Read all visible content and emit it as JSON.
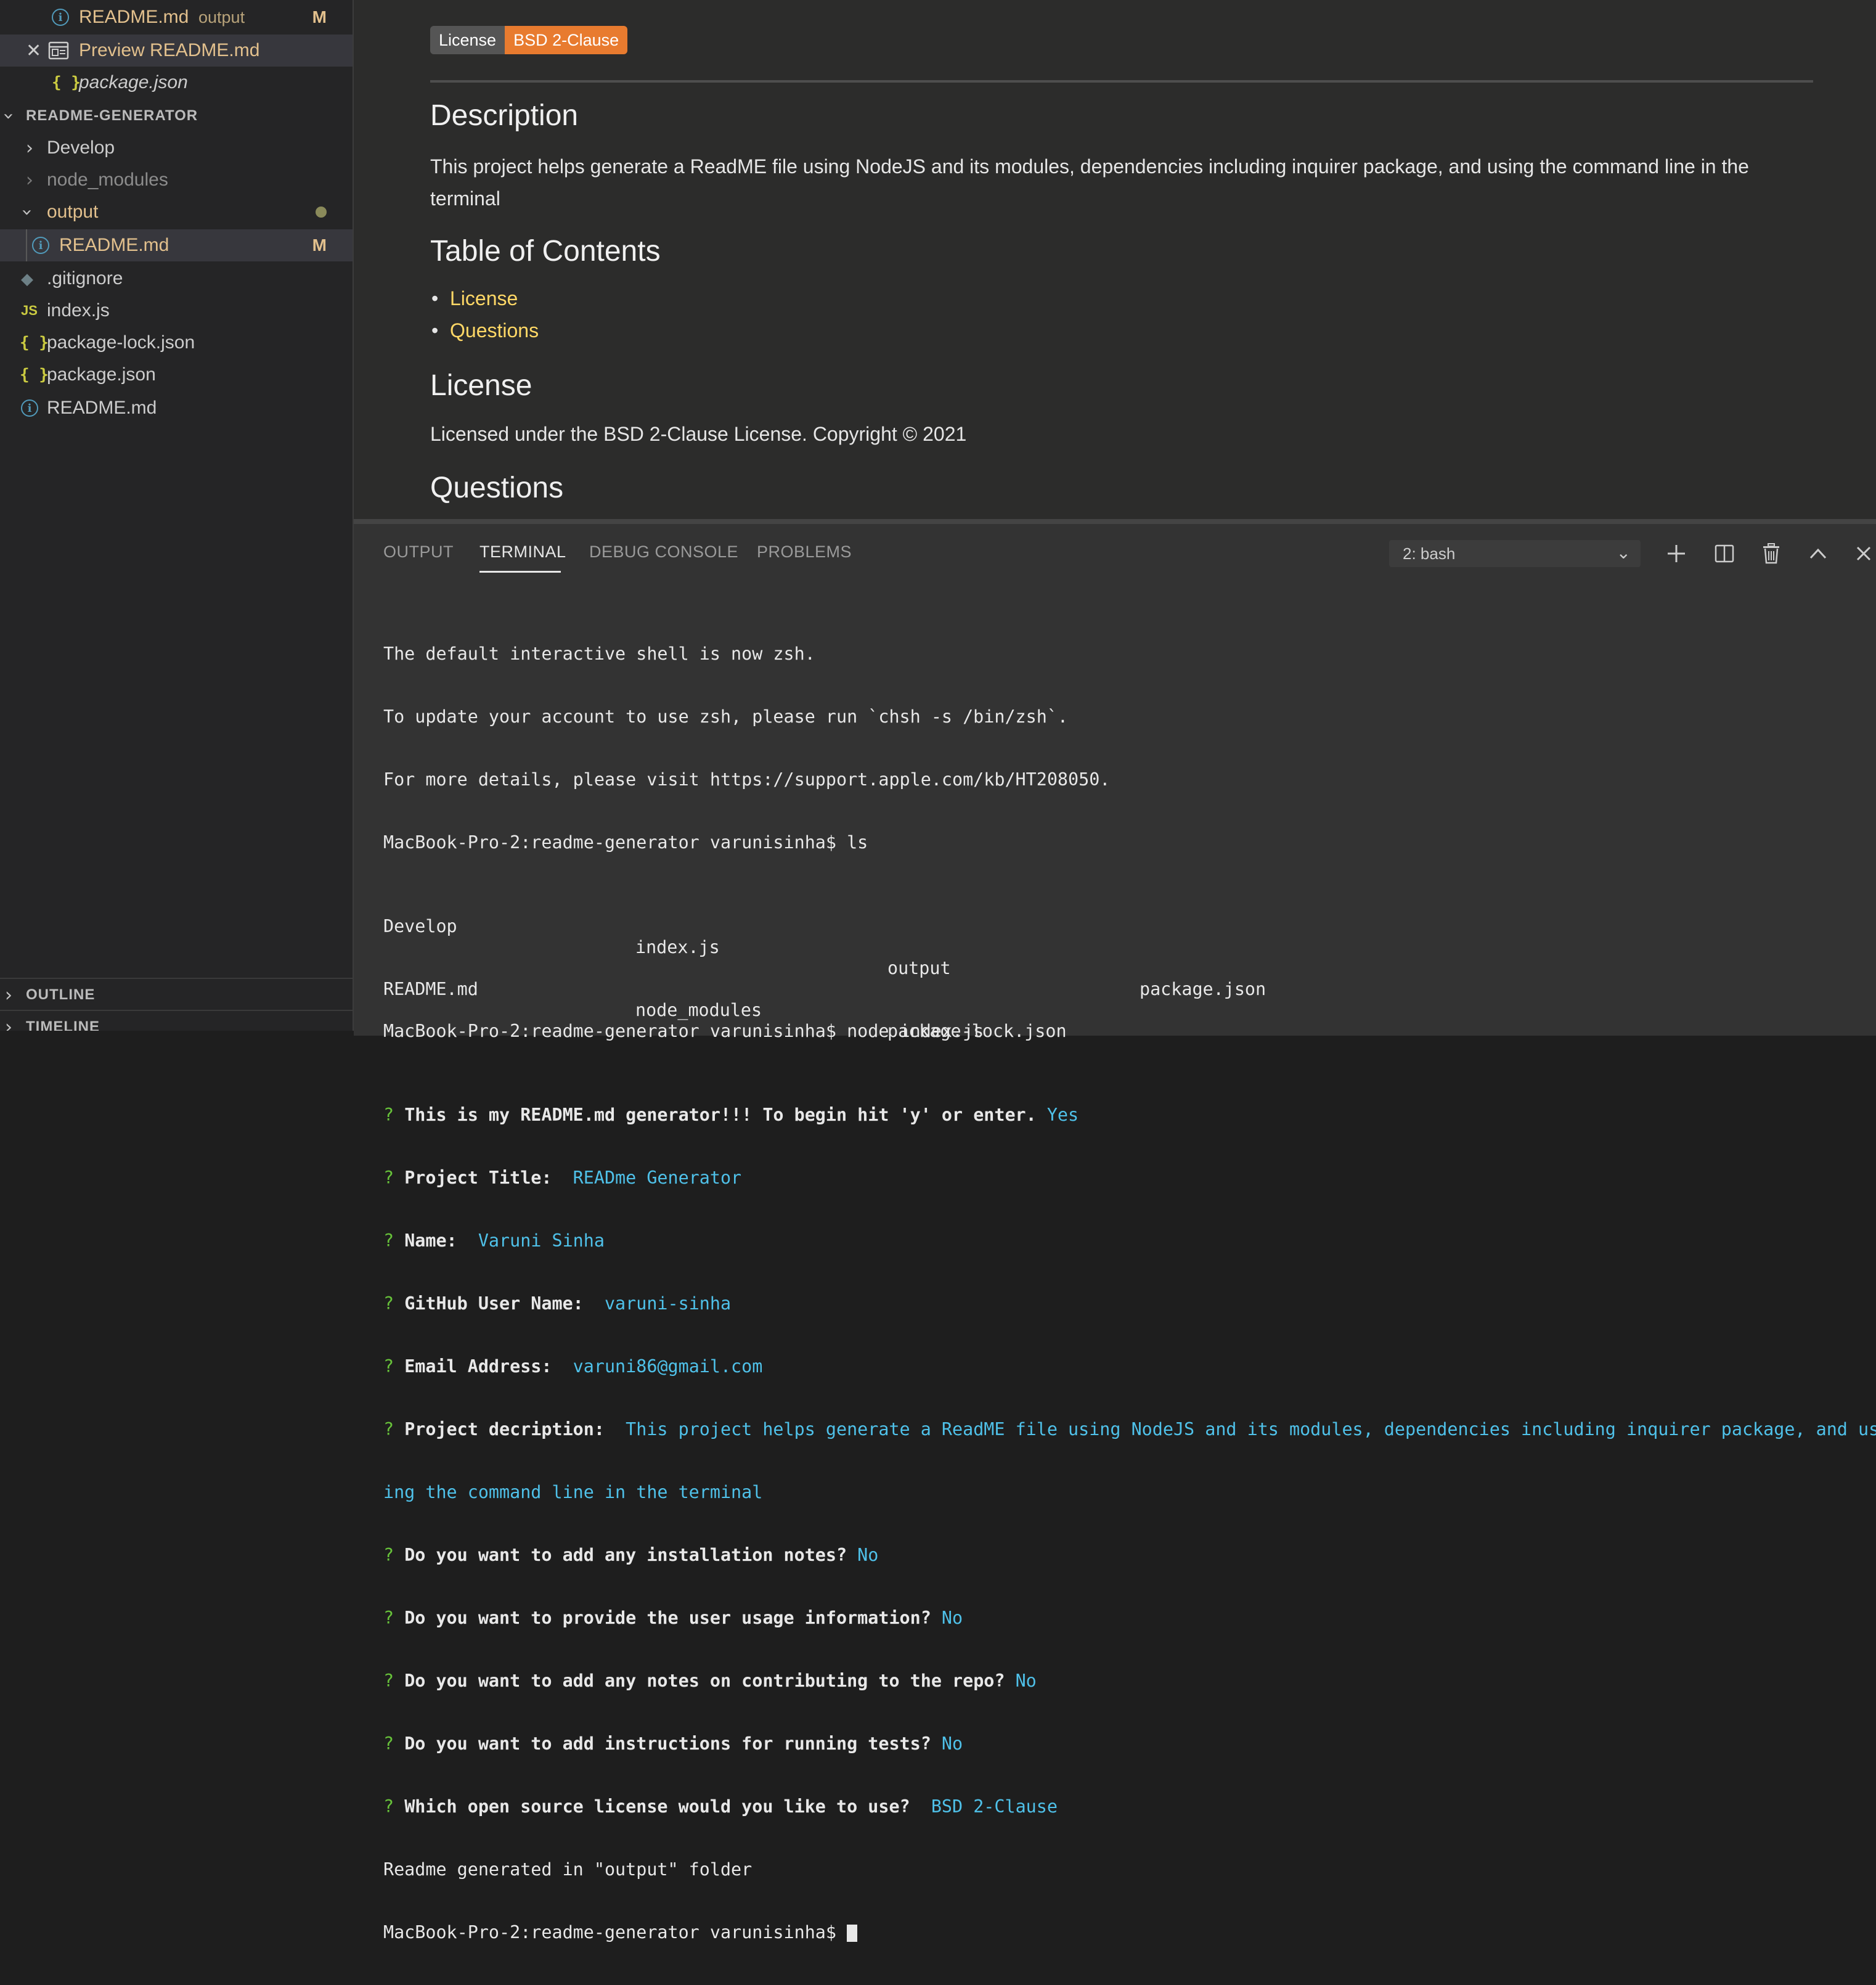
{
  "sidebar": {
    "open_editors": [
      {
        "name": "README.md",
        "hint": "output",
        "badge": "M"
      },
      {
        "name": "Preview README.md"
      },
      {
        "name": "package.json"
      }
    ],
    "project_title": "README-GENERATOR",
    "tree": [
      {
        "name": "Develop"
      },
      {
        "name": "node_modules"
      },
      {
        "name": "output"
      },
      {
        "name": "README.md",
        "badge": "M"
      },
      {
        "name": ".gitignore"
      },
      {
        "name": "index.js"
      },
      {
        "name": "package-lock.json"
      },
      {
        "name": "package.json"
      },
      {
        "name": "README.md"
      }
    ],
    "outline": "OUTLINE",
    "timeline": "TIMELINE",
    "js_icon_text": "JS",
    "info_icon_text": "i",
    "brace_icon_text": "{ }"
  },
  "preview": {
    "badge_left": "License",
    "badge_right": "BSD 2-Clause",
    "h_description": "Description",
    "description": "This project helps generate a ReadME file using NodeJS and its modules, dependencies including inquirer package, and using the command line in the terminal",
    "h_toc": "Table of Contents",
    "toc": [
      "License",
      "Questions"
    ],
    "h_license": "License",
    "license_text": "Licensed under the BSD 2-Clause License. Copyright © 2021",
    "h_questions": "Questions"
  },
  "panel": {
    "tabs": [
      "OUTPUT",
      "TERMINAL",
      "DEBUG CONSOLE",
      "PROBLEMS"
    ],
    "active_tab": "TERMINAL",
    "terminal_select": "2: bash"
  },
  "terminal": {
    "lines": [
      "The default interactive shell is now zsh.",
      "To update your account to use zsh, please run `chsh -s /bin/zsh`.",
      "For more details, please visit https://support.apple.com/kb/HT208050.",
      "MacBook-Pro-2:readme-generator varunisinha$ ls"
    ],
    "ls_row1": [
      "Develop",
      "index.js",
      "output",
      "package.json"
    ],
    "ls_row2": [
      "README.md",
      "node_modules",
      "package-lock.json"
    ],
    "node_cmd": "MacBook-Pro-2:readme-generator varunisinha$ node index.js",
    "prompts": [
      {
        "q": "This is my README.md generator!!! To begin hit 'y' or enter.",
        "a": "Yes"
      },
      {
        "q": "Project Title: ",
        "a": "READme Generator"
      },
      {
        "q": "Name: ",
        "a": "Varuni Sinha"
      },
      {
        "q": "GitHub User Name: ",
        "a": "varuni-sinha"
      },
      {
        "q": "Email Address: ",
        "a": "varuni86@gmail.com"
      },
      {
        "q": "Project decription: ",
        "a": "This project helps generate a ReadME file using NodeJS and its modules, dependencies including inquirer package, and us"
      },
      {
        "q": "Do you want to add any installation notes?",
        "a": "No"
      },
      {
        "q": "Do you want to provide the user usage information?",
        "a": "No"
      },
      {
        "q": "Do you want to add any notes on contributing to the repo?",
        "a": "No"
      },
      {
        "q": "Do you want to add instructions for running tests?",
        "a": "No"
      },
      {
        "q": "Which open source license would you like to use? ",
        "a": "BSD 2-Clause"
      }
    ],
    "wrap_line": "ing the command line in the terminal",
    "done_msg": "Readme generated in \"output\" folder",
    "final_prompt": "MacBook-Pro-2:readme-generator varunisinha$ ",
    "q_mark": "?"
  },
  "colors": {
    "accent_yellow": "#e2c08d",
    "link": "#ffd866",
    "answer": "#4fc1e9",
    "prompt_q": "#67c23a",
    "badge_orange": "#e87b2f"
  }
}
